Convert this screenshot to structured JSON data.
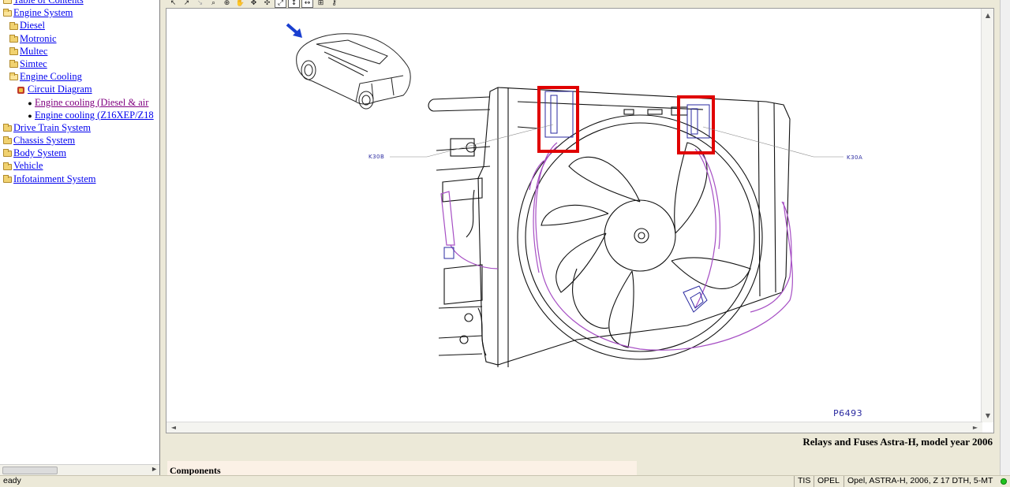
{
  "tree": {
    "items": [
      {
        "label": "Table of Contents",
        "indent": 0,
        "icon": "folder-open-icon",
        "visited": false
      },
      {
        "label": "Engine System",
        "indent": 1,
        "icon": "folder-open-icon",
        "visited": false
      },
      {
        "label": "Diesel",
        "indent": 2,
        "icon": "folder-icon",
        "visited": false
      },
      {
        "label": "Motronic",
        "indent": 2,
        "icon": "folder-icon",
        "visited": false
      },
      {
        "label": "Multec",
        "indent": 2,
        "icon": "folder-icon",
        "visited": false
      },
      {
        "label": "Simtec",
        "indent": 2,
        "icon": "folder-icon",
        "visited": false
      },
      {
        "label": "Engine Cooling",
        "indent": 2,
        "icon": "folder-open-icon",
        "visited": false
      },
      {
        "label": "Circuit Diagram",
        "indent": 3,
        "icon": "diagram-icon",
        "visited": false
      },
      {
        "label": "Engine cooling (Diesel & air",
        "indent": 4,
        "icon": "bullet-icon",
        "visited": true
      },
      {
        "label": "Engine cooling (Z16XEP/Z18",
        "indent": 4,
        "icon": "bullet-icon",
        "visited": false
      },
      {
        "label": "Drive Train System",
        "indent": 0,
        "icon": "folder-icon",
        "visited": false
      },
      {
        "label": "Chassis System",
        "indent": 0,
        "icon": "folder-icon",
        "visited": false
      },
      {
        "label": "Body System",
        "indent": 0,
        "icon": "folder-icon",
        "visited": false
      },
      {
        "label": "Vehicle",
        "indent": 0,
        "icon": "folder-icon",
        "visited": false
      },
      {
        "label": "Infotainment System",
        "indent": 0,
        "icon": "folder-icon",
        "visited": false
      }
    ]
  },
  "toolbar": {
    "tools": [
      "select-arrow-icon",
      "select-plus-icon",
      "select-minus-icon",
      "zoom-icon",
      "zoom-area-icon",
      "pan-hand-icon",
      "move-icon",
      "expand-icon",
      "fit-window-icon",
      "fit-height-icon",
      "fit-width-icon",
      "measure-icon",
      "key-icon"
    ]
  },
  "diagram": {
    "figure_id": "P6493",
    "label_left": "K30B",
    "label_right": "K30A",
    "highlight_color": "#e00000",
    "harness_color": "#a64fc4",
    "connector_color": "#2a2aa0"
  },
  "document": {
    "title": "Relays and Fuses Astra-H, model year 2006",
    "components_heading": "Components"
  },
  "status_bar": {
    "text": "eady",
    "cells": [
      "TIS",
      "OPEL",
      "Opel, ASTRA-H, 2006, Z 17 DTH, 5-MT"
    ]
  }
}
